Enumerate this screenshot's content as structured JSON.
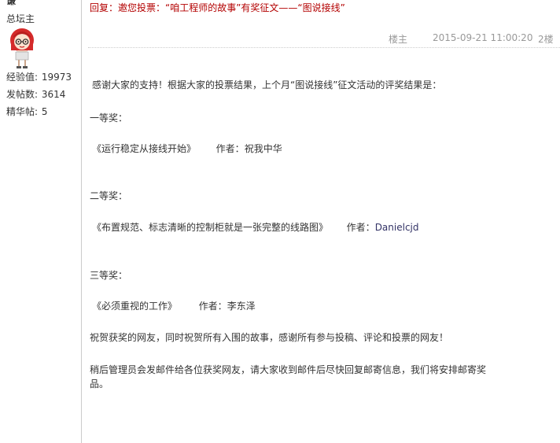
{
  "user": {
    "name": "谦",
    "role": "总坛主",
    "stats": [
      {
        "label": "经验值:",
        "value": "19973"
      },
      {
        "label": "发帖数:",
        "value": "3614"
      },
      {
        "label": "精华帖:",
        "value": "5"
      }
    ]
  },
  "post": {
    "title": "回复：邀您投票：“咱工程师的故事”有奖征文——“图说接线”",
    "author_tag": "楼主",
    "timestamp": "2015-09-21 11:00:20",
    "floor": "2楼"
  },
  "content": {
    "intro": "感谢大家的支持！根据大家的投票结果，上个月“图说接线”征文活动的评奖结果是：",
    "first_prize_label": "一等奖：",
    "first_prize_entry": "《运行稳定从接线开始》",
    "first_prize_author_label": "作者：",
    "first_prize_author": "祝我中华",
    "second_prize_label": "二等奖：",
    "second_prize_entry": "《布置规范、标志清晰的控制柜就是一张完整的线路图》",
    "second_prize_author_label": "作者：",
    "second_prize_author": "Danielcjd",
    "third_prize_label": "三等奖：",
    "third_prize_entry": "《必须重视的工作》",
    "third_prize_author_label": "作者：",
    "third_prize_author": "李东泽",
    "congrats": "祝贺获奖的网友，同时祝贺所有入围的故事，感谢所有参与投稿、评论和投票的网友！",
    "closing": "稍后管理员会发邮件给各位获奖网友，请大家收到邮件后尽快回复邮寄信息，我们将安排邮寄奖品。"
  },
  "colors": {
    "title": "#b30000",
    "meta": "#999999",
    "text": "#333333"
  }
}
